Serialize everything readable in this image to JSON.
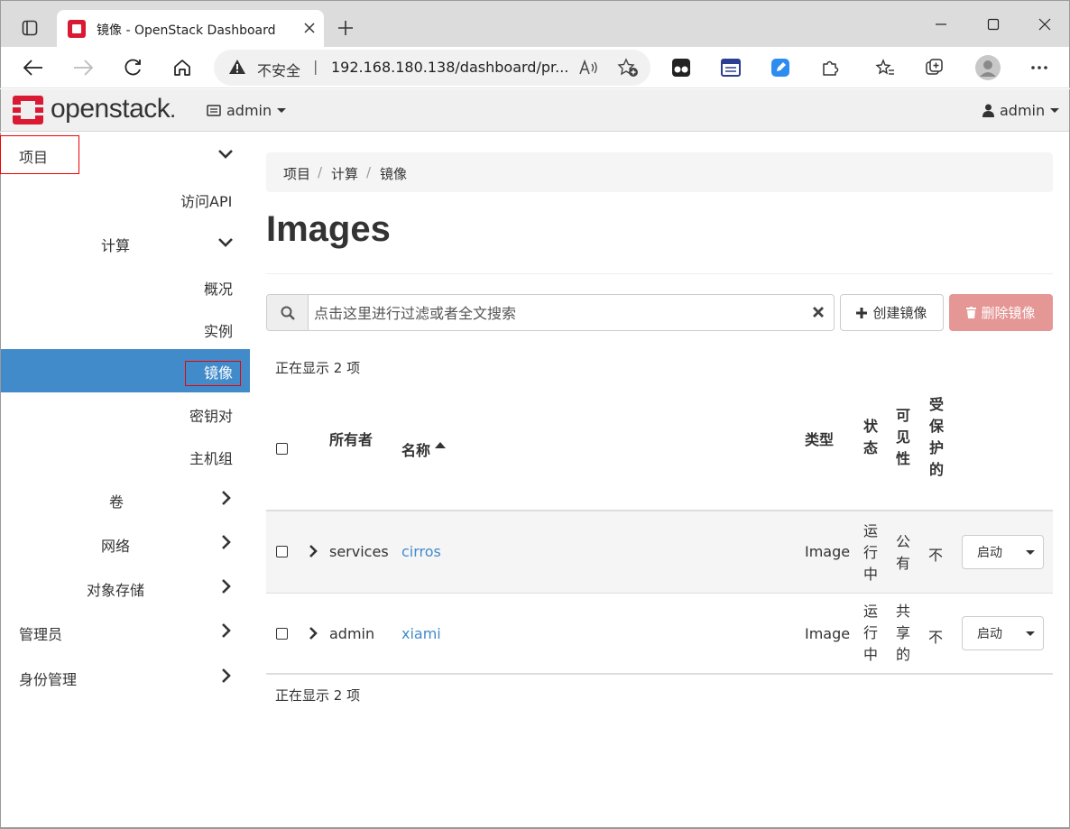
{
  "browser": {
    "tab_title": "镜像 - OpenStack Dashboard",
    "address_security": "不安全",
    "address_separator": "|",
    "address_url": "192.168.180.138/dashboard/pr...",
    "read_aloud_label": "A)"
  },
  "topnav": {
    "brand": "openstack",
    "brand_mark": ".",
    "project_label": "admin",
    "user_label": "admin"
  },
  "sidebar": {
    "project": "项目",
    "api_access": "访问API",
    "compute": "计算",
    "overview": "概况",
    "instances": "实例",
    "images": "镜像",
    "key_pairs": "密钥对",
    "server_groups": "主机组",
    "volumes": "卷",
    "network": "网络",
    "object_store": "对象存储",
    "admin": "管理员",
    "identity": "身份管理"
  },
  "breadcrumb": {
    "items": [
      "项目",
      "计算",
      "镜像"
    ],
    "sep": "/"
  },
  "page": {
    "title": "Images"
  },
  "toolbar": {
    "search_placeholder": "点击这里进行过滤或者全文搜索",
    "create_label": "创建镜像",
    "delete_label": "删除镜像"
  },
  "table": {
    "count_top": "正在显示 2 项",
    "count_bottom": "正在显示 2 项",
    "headers": {
      "owner": "所有者",
      "name": "名称",
      "type": "类型",
      "status": [
        "状",
        "态"
      ],
      "visibility": [
        "可",
        "见",
        "性"
      ],
      "protected": [
        "受",
        "保",
        "护",
        "的"
      ]
    },
    "rows": [
      {
        "owner": "services",
        "name": "cirros",
        "type": "Image",
        "status": [
          "运",
          "行",
          "中"
        ],
        "visibility": [
          "公",
          "有"
        ],
        "protected": "不",
        "action": "启动"
      },
      {
        "owner": "admin",
        "name": "xiami",
        "type": "Image",
        "status": [
          "运",
          "行",
          "中"
        ],
        "visibility": [
          "共",
          "享",
          "的"
        ],
        "protected": "不",
        "action": "启动"
      }
    ]
  },
  "colors": {
    "accent": "#428bca",
    "brand_red": "#da1a32",
    "danger_disabled": "#e49795",
    "highlight_box": "#ee0000"
  }
}
